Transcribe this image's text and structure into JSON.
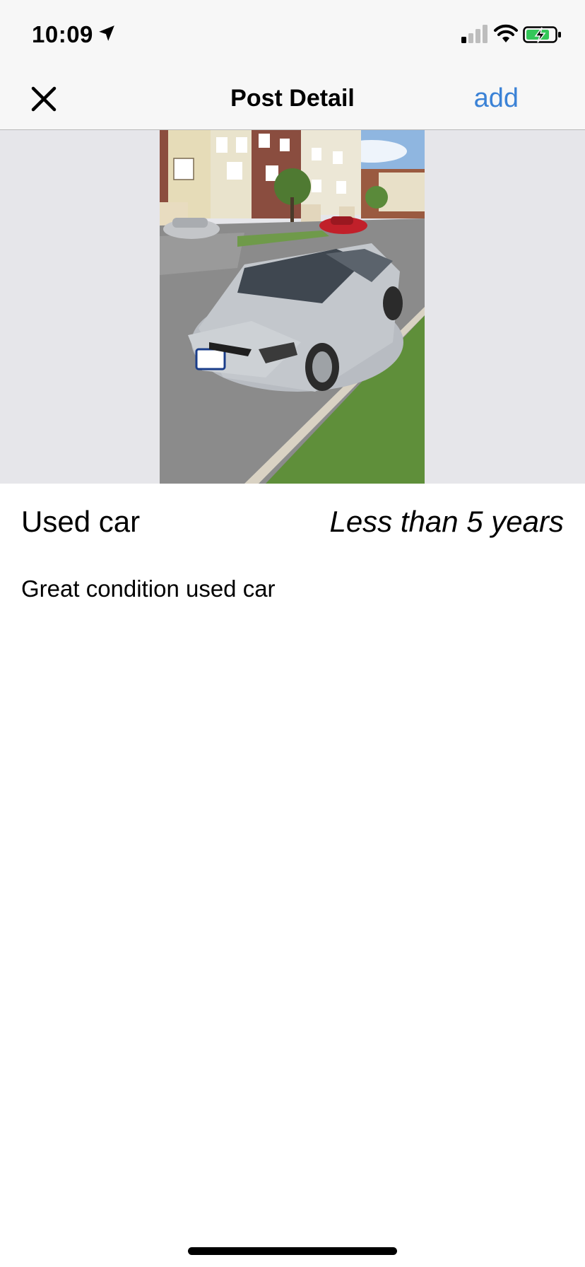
{
  "status_bar": {
    "time": "10:09",
    "icons": [
      "location-arrow-icon",
      "cellular-signal-icon",
      "wifi-icon",
      "battery-charging-icon"
    ]
  },
  "nav": {
    "title": "Post Detail",
    "close_icon": "close-icon",
    "add_label": "add",
    "accent_color": "#3b82d6"
  },
  "post": {
    "image": "photo of a silver sedan parked on a residential street",
    "title": "Used car",
    "age": "Less than 5 years",
    "description": "Great condition used car"
  }
}
